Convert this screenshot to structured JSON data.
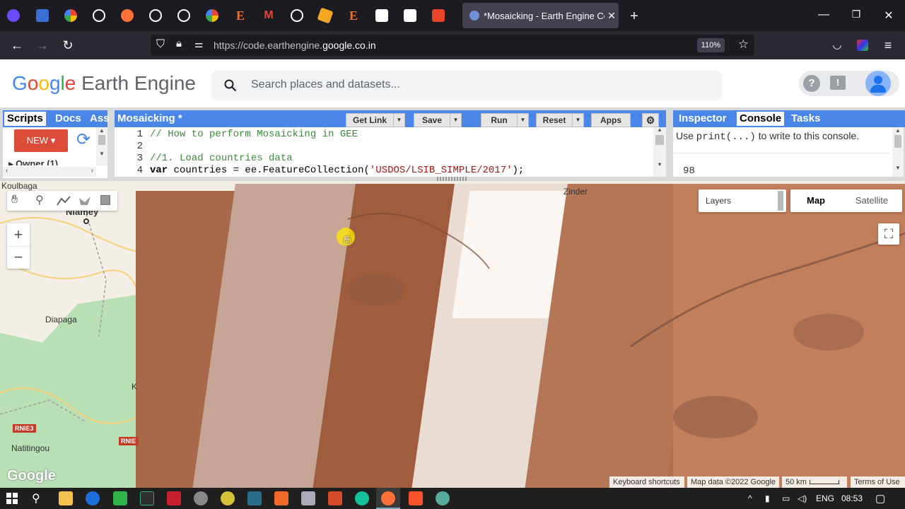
{
  "browser": {
    "pinned_tabs": [
      {
        "icon": "proton-icon",
        "color": "#6d4aff"
      },
      {
        "icon": "arrow-app-icon",
        "color": "#3b6fd4"
      },
      {
        "icon": "google-icon",
        "color": "#ffffff"
      },
      {
        "icon": "globe-icon",
        "color": "#fbfbfe"
      },
      {
        "icon": "firefox-icon",
        "color": "#ff7139"
      },
      {
        "icon": "globe-icon",
        "color": "#fbfbfe"
      },
      {
        "icon": "globe-icon",
        "color": "#fbfbfe"
      },
      {
        "icon": "google-icon",
        "color": "#ffffff"
      },
      {
        "icon": "e-letter-icon",
        "color": "#e8742a"
      },
      {
        "icon": "gmail-icon",
        "color": "#ea4335"
      },
      {
        "icon": "globe-icon",
        "color": "#fbfbfe"
      },
      {
        "icon": "tag-icon",
        "color": "#f5a623"
      },
      {
        "icon": "e-letter-icon",
        "color": "#e8742a"
      },
      {
        "icon": "code-icon",
        "color": "#ffffff"
      },
      {
        "icon": "code-icon",
        "color": "#ffffff"
      },
      {
        "icon": "t-letter-icon",
        "color": "#e8452a"
      }
    ],
    "active_tab_title": "*Mosaicking - Earth Engine Cod",
    "url_prefix": "https://code.earthengine.",
    "url_domain": "google.co.in",
    "zoom": "110%"
  },
  "header": {
    "logo_g": "G",
    "logo_o1": "o",
    "logo_o2": "o",
    "logo_g2": "g",
    "logo_l": "l",
    "logo_e": "e",
    "logo_rest": "Earth Engine",
    "search_placeholder": "Search places and datasets..."
  },
  "left_panel": {
    "tabs": [
      "Scripts",
      "Docs",
      "Ass"
    ],
    "new_label": "NEW",
    "owner_label": "Owner (1)"
  },
  "editor": {
    "title": "Mosaicking *",
    "buttons": {
      "get_link": "Get Link",
      "save": "Save",
      "run": "Run",
      "reset": "Reset",
      "apps": "Apps"
    },
    "lines": [
      {
        "num": "1",
        "comment": "// How to perform Mosaicking in GEE"
      },
      {
        "num": "2",
        "comment": ""
      },
      {
        "num": "3",
        "comment": "//1. Load countries data"
      },
      {
        "num": "4",
        "kw": "var",
        "pre": " countries = ee.FeatureCollection(",
        "str": "'USDOS/LSIB_SIMPLE/2017'",
        "post": ");"
      }
    ]
  },
  "right_panel": {
    "tabs": [
      "Inspector",
      "Console",
      "Tasks"
    ],
    "hint_pre": "Use ",
    "hint_code": "print(...)",
    "hint_post": " to write to this console.",
    "output": "98"
  },
  "map": {
    "labels": [
      "Koulbaga",
      "Niamey",
      "Diapaga",
      "Natitingou",
      "Zinder",
      "K"
    ],
    "roads": [
      "RNIE3",
      "RNIE"
    ],
    "layers_label": "Layers",
    "map_type": "Map",
    "satellite_type": "Satellite",
    "zoom_in": "+",
    "zoom_out": "−",
    "google_logo": "Google",
    "attribution": {
      "shortcuts": "Keyboard shortcuts",
      "data": "Map data ©2022 Google",
      "scale": "50 km",
      "terms": "Terms of Use"
    }
  },
  "taskbar": {
    "lang": "ENG",
    "time": "08:53"
  }
}
